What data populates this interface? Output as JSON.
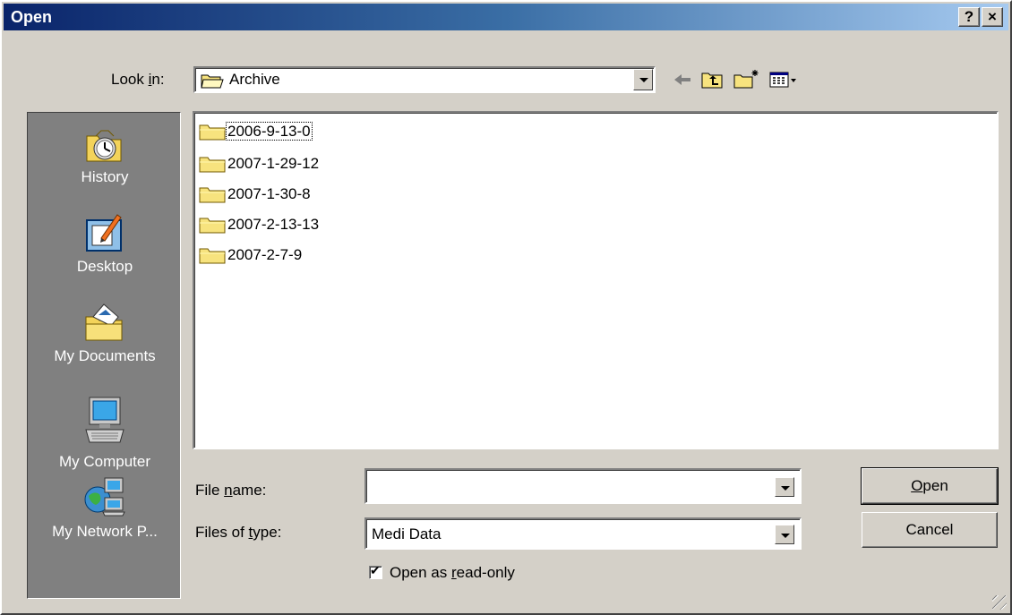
{
  "window": {
    "title": "Open",
    "help_glyph": "?",
    "close_glyph": "×"
  },
  "look_in": {
    "label_pre": "Look ",
    "label_key": "i",
    "label_post": "n:",
    "value": "Archive"
  },
  "toolbar": {
    "back": "back-arrow-icon",
    "up": "up-folder-icon",
    "new_folder": "new-folder-icon",
    "view": "view-menu-icon"
  },
  "places": [
    {
      "label": "History",
      "icon": "history-icon"
    },
    {
      "label": "Desktop",
      "icon": "desktop-icon"
    },
    {
      "label": "My Documents",
      "icon": "my-documents-icon"
    },
    {
      "label": "My Computer",
      "icon": "my-computer-icon"
    },
    {
      "label": "My Network P...",
      "icon": "my-network-places-icon"
    }
  ],
  "files": [
    "2006-9-13-0",
    "2007-1-29-12",
    "2007-1-30-8",
    "2007-2-13-13",
    "2007-2-7-9"
  ],
  "file_name": {
    "label_pre": "File ",
    "label_key": "n",
    "label_post": "ame:",
    "value": ""
  },
  "files_of_type": {
    "label_pre": "Files of ",
    "label_key": "t",
    "label_post": "ype:",
    "value": "Medi Data"
  },
  "read_only": {
    "pre": "Open as ",
    "key": "r",
    "post": "ead-only",
    "checked": true,
    "check_glyph": "✔"
  },
  "buttons": {
    "open_key": "O",
    "open_rest": "pen",
    "cancel": "Cancel"
  }
}
